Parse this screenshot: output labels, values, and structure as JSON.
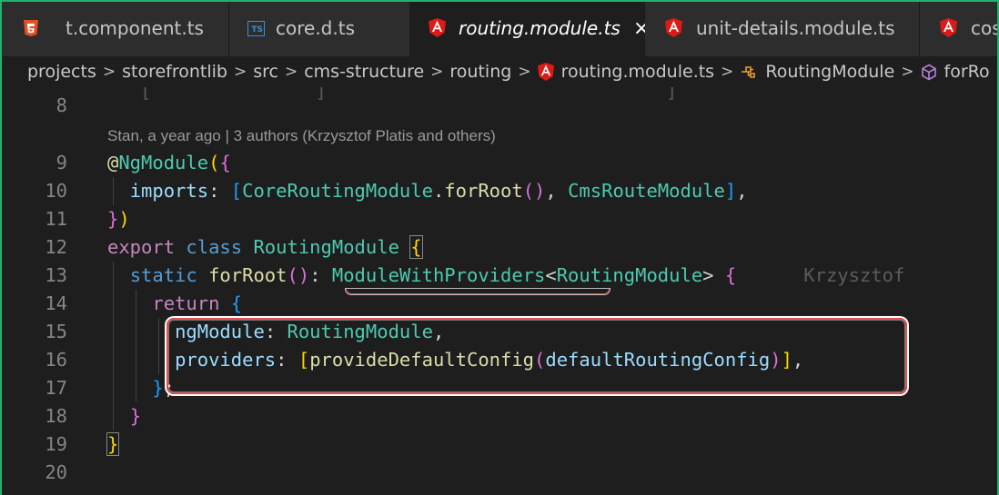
{
  "tabs": [
    {
      "label": "t.component.ts",
      "icon": "html5-icon",
      "active": false
    },
    {
      "label": "core.d.ts",
      "icon": "typescript-icon",
      "active": false
    },
    {
      "label": "routing.module.ts",
      "icon": "angular-icon",
      "active": true
    },
    {
      "label": "unit-details.module.ts",
      "icon": "angular-icon",
      "active": false
    },
    {
      "label": "cos",
      "icon": "angular-icon",
      "active": false
    }
  ],
  "breadcrumb": [
    "projects",
    "storefrontlib",
    "src",
    "cms-structure",
    "routing",
    "routing.module.ts",
    "RoutingModule",
    "forRo"
  ],
  "codelens": "Stan, a year ago | 3 authors (Krzysztof Platis and others)",
  "line_numbers": [
    "8",
    "9",
    "10",
    "11",
    "12",
    "13",
    "14",
    "15",
    "16",
    "17",
    "18",
    "19",
    "20"
  ],
  "code": {
    "decorator": "@",
    "decorator_name": "NgModule",
    "imports_key": "imports",
    "core_routing_module": "CoreRoutingModule",
    "for_root": "forRoot",
    "cms_route_module": "CmsRouteModule",
    "export_kw": "export",
    "class_kw": "class",
    "class_name": "RoutingModule",
    "static_kw": "static",
    "method_name": "forRoot",
    "return_type": "ModuleWithProviders",
    "type_arg": "RoutingModule",
    "inline_blame": "Krzysztof",
    "return_kw": "return",
    "ngmodule_key": "ngModule",
    "ngmodule_value": "RoutingModule",
    "providers_key": "providers",
    "provide_fn": "provideDefaultConfig",
    "config_arg": "defaultRoutingConfig"
  },
  "colors": {
    "accent_frame": "#1fb36b",
    "annotation": "#e05050",
    "angular": "#dd1b16",
    "typescript": "#3a8fd6"
  }
}
